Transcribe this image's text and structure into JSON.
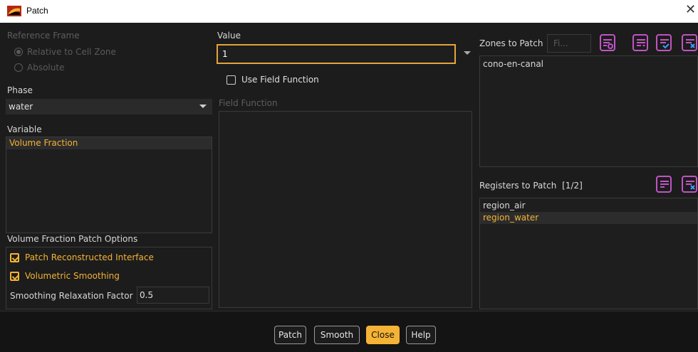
{
  "window": {
    "title": "Patch",
    "close_glyph": "✕"
  },
  "reference_frame": {
    "label": "Reference Frame",
    "options": [
      "Relative to Cell Zone",
      "Absolute"
    ],
    "selected": "Relative to Cell Zone"
  },
  "phase": {
    "label": "Phase",
    "value": "water"
  },
  "variable": {
    "label": "Variable",
    "items": [
      "Volume Fraction"
    ],
    "selected": "Volume Fraction"
  },
  "vf_options": {
    "label": "Volume Fraction Patch Options",
    "patch_reconstructed": {
      "label": "Patch Reconstructed Interface",
      "checked": true
    },
    "volumetric_smoothing": {
      "label": "Volumetric Smoothing",
      "checked": true
    },
    "relaxation": {
      "label": "Smoothing Relaxation Factor",
      "value": "0.5"
    }
  },
  "value": {
    "label": "Value",
    "input": "1"
  },
  "use_field_function": {
    "label": "Use Field Function",
    "checked": false
  },
  "field_function": {
    "label": "Field Function"
  },
  "zones": {
    "label": "Zones to Patch",
    "filter_placeholder": "Fi...",
    "items": [
      "cono-en-canal"
    ]
  },
  "registers": {
    "label": "Registers to Patch",
    "count": "[1/2]",
    "items": [
      "region_air",
      "region_water"
    ],
    "selected": "region_water"
  },
  "footer": {
    "patch": "Patch",
    "smooth": "Smooth",
    "close": "Close",
    "help": "Help"
  },
  "colors": {
    "accent": "#f5b335",
    "toolbar_icon": "#c054c4",
    "background": "#1c1c1c"
  },
  "icons": [
    "fluent-app-icon",
    "close-icon",
    "filter-toggle-icon",
    "list-menu-icon",
    "select-all-icon",
    "deselect-all-icon"
  ]
}
